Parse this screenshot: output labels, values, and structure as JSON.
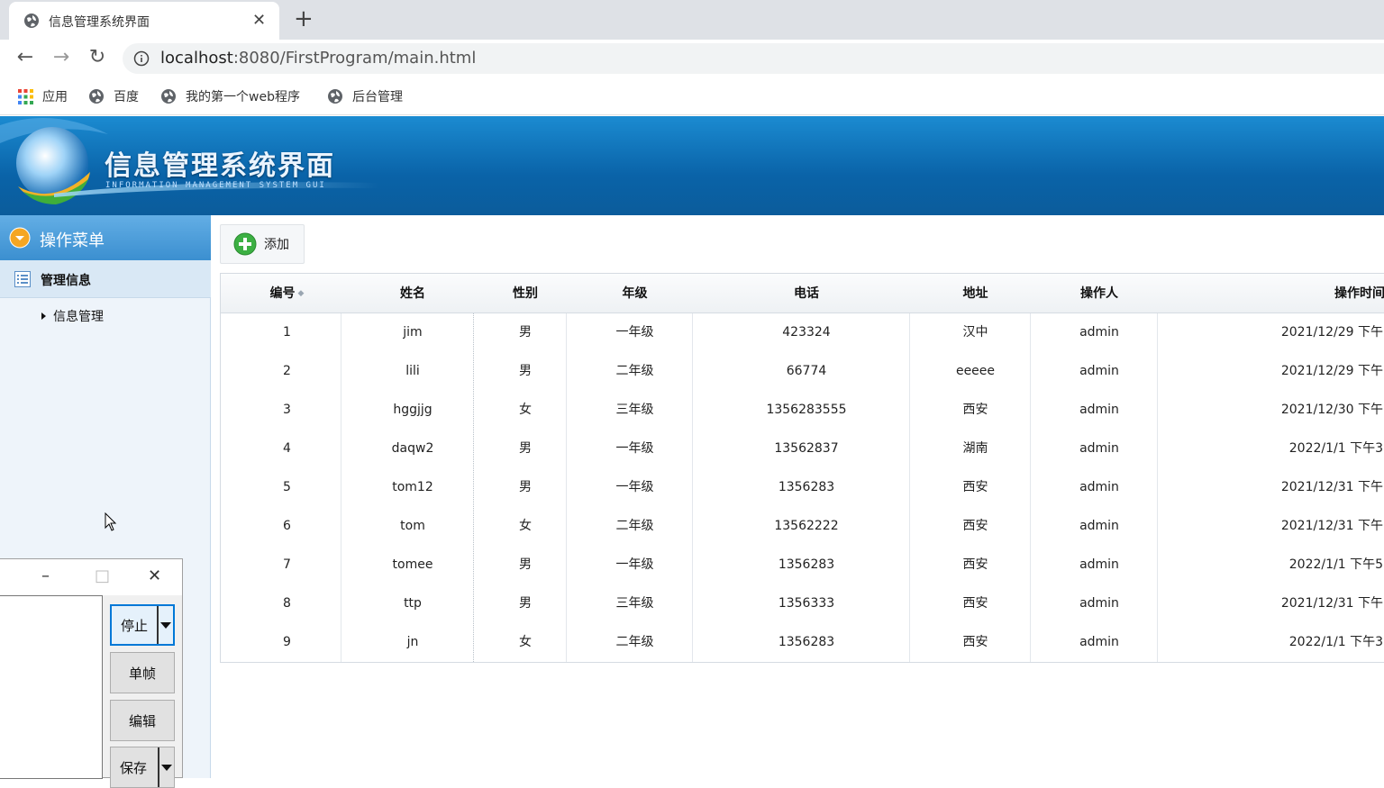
{
  "browser": {
    "tab_title": "信息管理系统界面",
    "tab_close": "✕",
    "new_tab": "+",
    "url_host": "localhost",
    "url_path": ":8080/FirstProgram/main.html",
    "nav": {
      "back": "←",
      "forward": "→",
      "reload": "↻"
    },
    "bookmarks": [
      {
        "label": "应用",
        "icon": "apps-grid-icon"
      },
      {
        "label": "百度",
        "icon": "globe-icon"
      },
      {
        "label": "我的第一个web程序",
        "icon": "globe-icon"
      },
      {
        "label": "后台管理",
        "icon": "globe-icon"
      }
    ]
  },
  "header": {
    "title": "信息管理系统界面",
    "subtitle": "INFORMATION MANAGEMENT SYSTEM GUI",
    "colors": {
      "bg_top": "#1b8bd1",
      "bg_bottom": "#0b5c9b"
    }
  },
  "sidebar": {
    "menu_title": "操作菜单",
    "section_label": "管理信息",
    "tree_item": "信息管理"
  },
  "toolbar": {
    "add_label": "添加"
  },
  "table": {
    "columns": [
      "编号",
      "姓名",
      "性别",
      "年级",
      "电话",
      "地址",
      "操作人",
      "操作时间"
    ],
    "rows": [
      [
        "1",
        "jim",
        "男",
        "一年级",
        "423324",
        "汉中",
        "admin",
        "2021/12/29 下午"
      ],
      [
        "2",
        "lili",
        "男",
        "二年级",
        "66774",
        "eeeee",
        "admin",
        "2021/12/29 下午"
      ],
      [
        "3",
        "hggjjg",
        "女",
        "三年级",
        "1356283555",
        "西安",
        "admin",
        "2021/12/30 下午"
      ],
      [
        "4",
        "daqw2",
        "男",
        "一年级",
        "13562837",
        "湖南",
        "admin",
        "2022/1/1 下午3"
      ],
      [
        "5",
        "tom12",
        "男",
        "一年级",
        "1356283",
        "西安",
        "admin",
        "2021/12/31 下午"
      ],
      [
        "6",
        "tom",
        "女",
        "二年级",
        "13562222",
        "西安",
        "admin",
        "2021/12/31 下午"
      ],
      [
        "7",
        "tomee",
        "男",
        "一年级",
        "1356283",
        "西安",
        "admin",
        "2022/1/1 下午5"
      ],
      [
        "8",
        "ttp",
        "男",
        "三年级",
        "1356333",
        "西安",
        "admin",
        "2021/12/31 下午"
      ],
      [
        "9",
        "jn",
        "女",
        "二年级",
        "1356283",
        "西安",
        "admin",
        "2022/1/1 下午3"
      ]
    ]
  },
  "recorder": {
    "minimize": "–",
    "maximize": "□",
    "close": "✕",
    "buttons": [
      "停止",
      "单帧",
      "编辑",
      "保存"
    ]
  }
}
